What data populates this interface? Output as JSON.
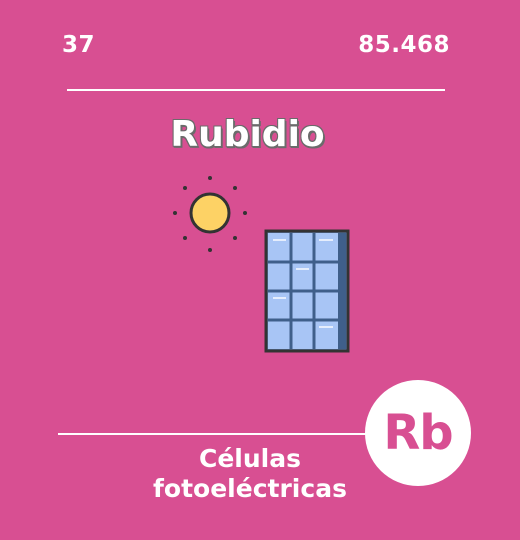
{
  "element": {
    "atomic_number": "37",
    "atomic_mass": "85.468",
    "name": "Rubidio",
    "symbol": "Rb"
  },
  "application": {
    "line1": "Células",
    "line2": "fotoeléctricas"
  },
  "icons": {
    "sun": "sun-icon",
    "panel": "solar-panel-icon"
  },
  "colors": {
    "background": "#d84f92",
    "text": "#ffffff",
    "sun": "#fdd265",
    "panel_glass": "#a8c5f5",
    "panel_frame": "#5b7aa6",
    "outline": "#333333"
  }
}
